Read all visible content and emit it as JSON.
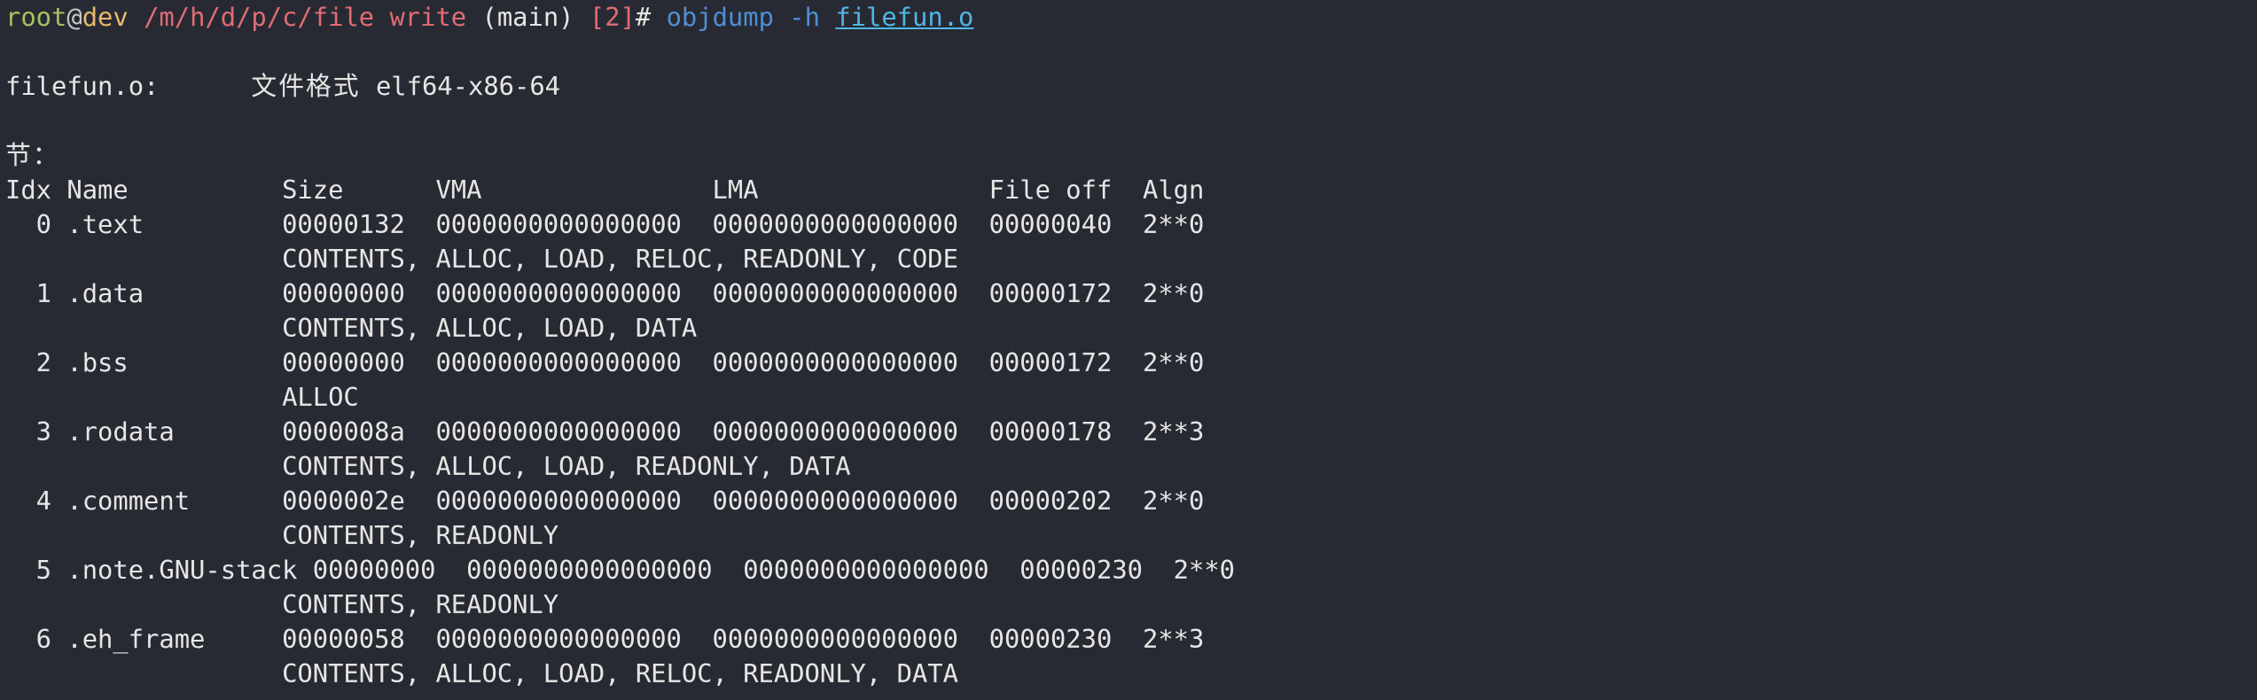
{
  "prompt": {
    "user": "root",
    "at": "@",
    "host": "dev",
    "path": "/m/h/d/p/c/file write",
    "branch": "(main)",
    "status": "[2]",
    "symbol": "#",
    "command": "objdump",
    "flag": "-h",
    "argument": "filefun.o"
  },
  "file_header": {
    "filename": "filefun.o:",
    "format_label": "文件格式",
    "format_value": "elf64-x86-64"
  },
  "sections_label": "节：",
  "columns": [
    "Idx",
    "Name",
    "Size",
    "VMA",
    "LMA",
    "File off",
    "Algn"
  ],
  "sections": [
    {
      "idx": "0",
      "name": ".text",
      "size": "00000132",
      "vma": "0000000000000000",
      "lma": "0000000000000000",
      "file_off": "00000040",
      "algn": "2**0",
      "flags": "CONTENTS, ALLOC, LOAD, RELOC, READONLY, CODE"
    },
    {
      "idx": "1",
      "name": ".data",
      "size": "00000000",
      "vma": "0000000000000000",
      "lma": "0000000000000000",
      "file_off": "00000172",
      "algn": "2**0",
      "flags": "CONTENTS, ALLOC, LOAD, DATA"
    },
    {
      "idx": "2",
      "name": ".bss",
      "size": "00000000",
      "vma": "0000000000000000",
      "lma": "0000000000000000",
      "file_off": "00000172",
      "algn": "2**0",
      "flags": "ALLOC"
    },
    {
      "idx": "3",
      "name": ".rodata",
      "size": "0000008a",
      "vma": "0000000000000000",
      "lma": "0000000000000000",
      "file_off": "00000178",
      "algn": "2**3",
      "flags": "CONTENTS, ALLOC, LOAD, READONLY, DATA"
    },
    {
      "idx": "4",
      "name": ".comment",
      "size": "0000002e",
      "vma": "0000000000000000",
      "lma": "0000000000000000",
      "file_off": "00000202",
      "algn": "2**0",
      "flags": "CONTENTS, READONLY"
    },
    {
      "idx": "5",
      "name": ".note.GNU-stack",
      "size": "00000000",
      "vma": "0000000000000000",
      "lma": "0000000000000000",
      "file_off": "00000230",
      "algn": "2**0",
      "flags": "CONTENTS, READONLY"
    },
    {
      "idx": "6",
      "name": ".eh_frame",
      "size": "00000058",
      "vma": "0000000000000000",
      "lma": "0000000000000000",
      "file_off": "00000230",
      "algn": "2**3",
      "flags": "CONTENTS, ALLOC, LOAD, RELOC, READONLY, DATA"
    }
  ],
  "colors": {
    "background": "#282a33",
    "text": "#e6e6e6",
    "user": "#a5c261",
    "host": "#e8b96a",
    "path": "#e06c75",
    "command": "#4f8fd6",
    "argument": "#4fb6e6"
  }
}
